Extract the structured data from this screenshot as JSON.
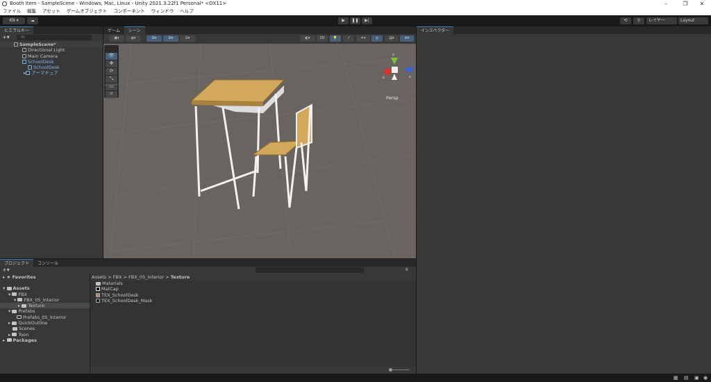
{
  "window": {
    "title": "Booth Item - SampleScene - Windows, Mac, Linux - Unity 2021.3.22f1 Personal* <DX11>",
    "minimize": "–",
    "maximize": "❐",
    "close": "✕"
  },
  "menu": [
    "ファイル",
    "編集",
    "アセット",
    "ゲームオブジェクト",
    "コンポーネント",
    "ウィンドウ",
    "ヘルプ"
  ],
  "toolbar": {
    "account": "KN ▾",
    "cloud": "☁",
    "play": "▶",
    "pause": "❚❚",
    "step": "▶|",
    "history": "⟲",
    "search": "⚲",
    "layers": "レイヤー",
    "layout": "Layout"
  },
  "hierarchy": {
    "tab": "ヒエラルキー",
    "add": "+▾",
    "search_placeholder": "All",
    "items": [
      {
        "label": "SampleScene*",
        "depth": 0,
        "bold": true
      },
      {
        "label": "Directional Light",
        "depth": 1
      },
      {
        "label": "Main Camera",
        "depth": 1
      },
      {
        "label": "SchoolDesk",
        "depth": 1,
        "blue": true
      },
      {
        "label": "SchoolDesk",
        "depth": 2,
        "blue": true
      },
      {
        "label": "アーマチュア",
        "depth": 2,
        "blue": true
      }
    ]
  },
  "scene": {
    "tabs": [
      "ゲーム",
      "シーン"
    ],
    "active_tab": "シーン",
    "mode_2d": "2D",
    "projection": "Persp",
    "gizmo_axes": [
      "x",
      "y",
      "z"
    ]
  },
  "inspector": {
    "tab": "インスペクター"
  },
  "project": {
    "tabs": [
      "プロジェクト",
      "コンソール"
    ],
    "add": "+▾",
    "badge": "6",
    "tree": [
      {
        "label": "Favorites",
        "depth": 0,
        "bold": true,
        "icon": "star"
      },
      {
        "label": "Assets",
        "depth": 0,
        "bold": true
      },
      {
        "label": "FBX",
        "depth": 1
      },
      {
        "label": "FBX_05_Interior",
        "depth": 2
      },
      {
        "label": "Texture",
        "depth": 3,
        "selected": true
      },
      {
        "label": "Prefabs",
        "depth": 1
      },
      {
        "label": "Prefabs_05_Interior",
        "depth": 2
      },
      {
        "label": "QuickOutline",
        "depth": 1
      },
      {
        "label": "Scenes",
        "depth": 1
      },
      {
        "label": "Toon",
        "depth": 1
      },
      {
        "label": "Packages",
        "depth": 0,
        "bold": true
      }
    ],
    "breadcrumb": [
      "Assets",
      "FBX",
      "FBX_05_Interior",
      "Texture"
    ],
    "files": [
      {
        "label": "Materials",
        "icon": "folder"
      },
      {
        "label": "MatCap",
        "icon": "texture"
      },
      {
        "label": "TEX_SchoolDesk",
        "icon": "texture"
      },
      {
        "label": "TEX_SchoolDesk_Mask",
        "icon": "texture"
      }
    ]
  },
  "colors": {
    "accent": "#3a79bb",
    "scene_bg": "#6a6460",
    "wood": "#d2a85a"
  }
}
